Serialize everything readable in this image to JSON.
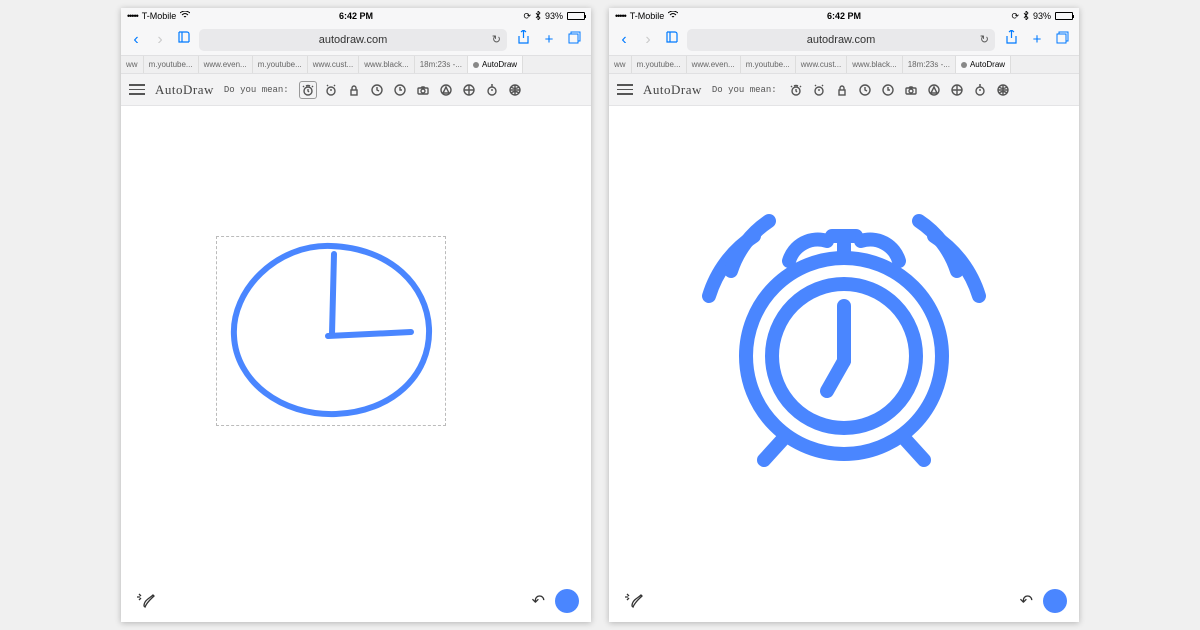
{
  "status": {
    "signal": "•••••",
    "carrier": "T-Mobile",
    "wifi": "on",
    "time": "6:42 PM",
    "bluetooth": "on",
    "battery_pct": "93%"
  },
  "browser": {
    "url": "autodraw.com",
    "back_enabled": true,
    "forward_enabled": false
  },
  "tabs": [
    {
      "label": "ww"
    },
    {
      "label": "m.youtube..."
    },
    {
      "label": "www.even..."
    },
    {
      "label": "m.youtube..."
    },
    {
      "label": "www.cust..."
    },
    {
      "label": "www.black..."
    },
    {
      "label": "18m:23s -..."
    },
    {
      "label": "AutoDraw",
      "active": true
    }
  ],
  "app": {
    "title": "AutoDraw",
    "prompt": "Do you mean:",
    "suggestions": [
      "alarm-clock-icon",
      "alarm-clock-alt-icon",
      "padlock-icon",
      "clock-icon",
      "clock-alt-icon",
      "camera-icon",
      "compass-icon",
      "target-icon",
      "stopwatch-icon",
      "basketball-icon"
    ]
  },
  "colors": {
    "stroke": "#4a86ff",
    "ios_tint": "#007aff"
  },
  "left_pane": {
    "content": "user-sketch-clock"
  },
  "right_pane": {
    "content": "suggested-alarm-clock"
  }
}
